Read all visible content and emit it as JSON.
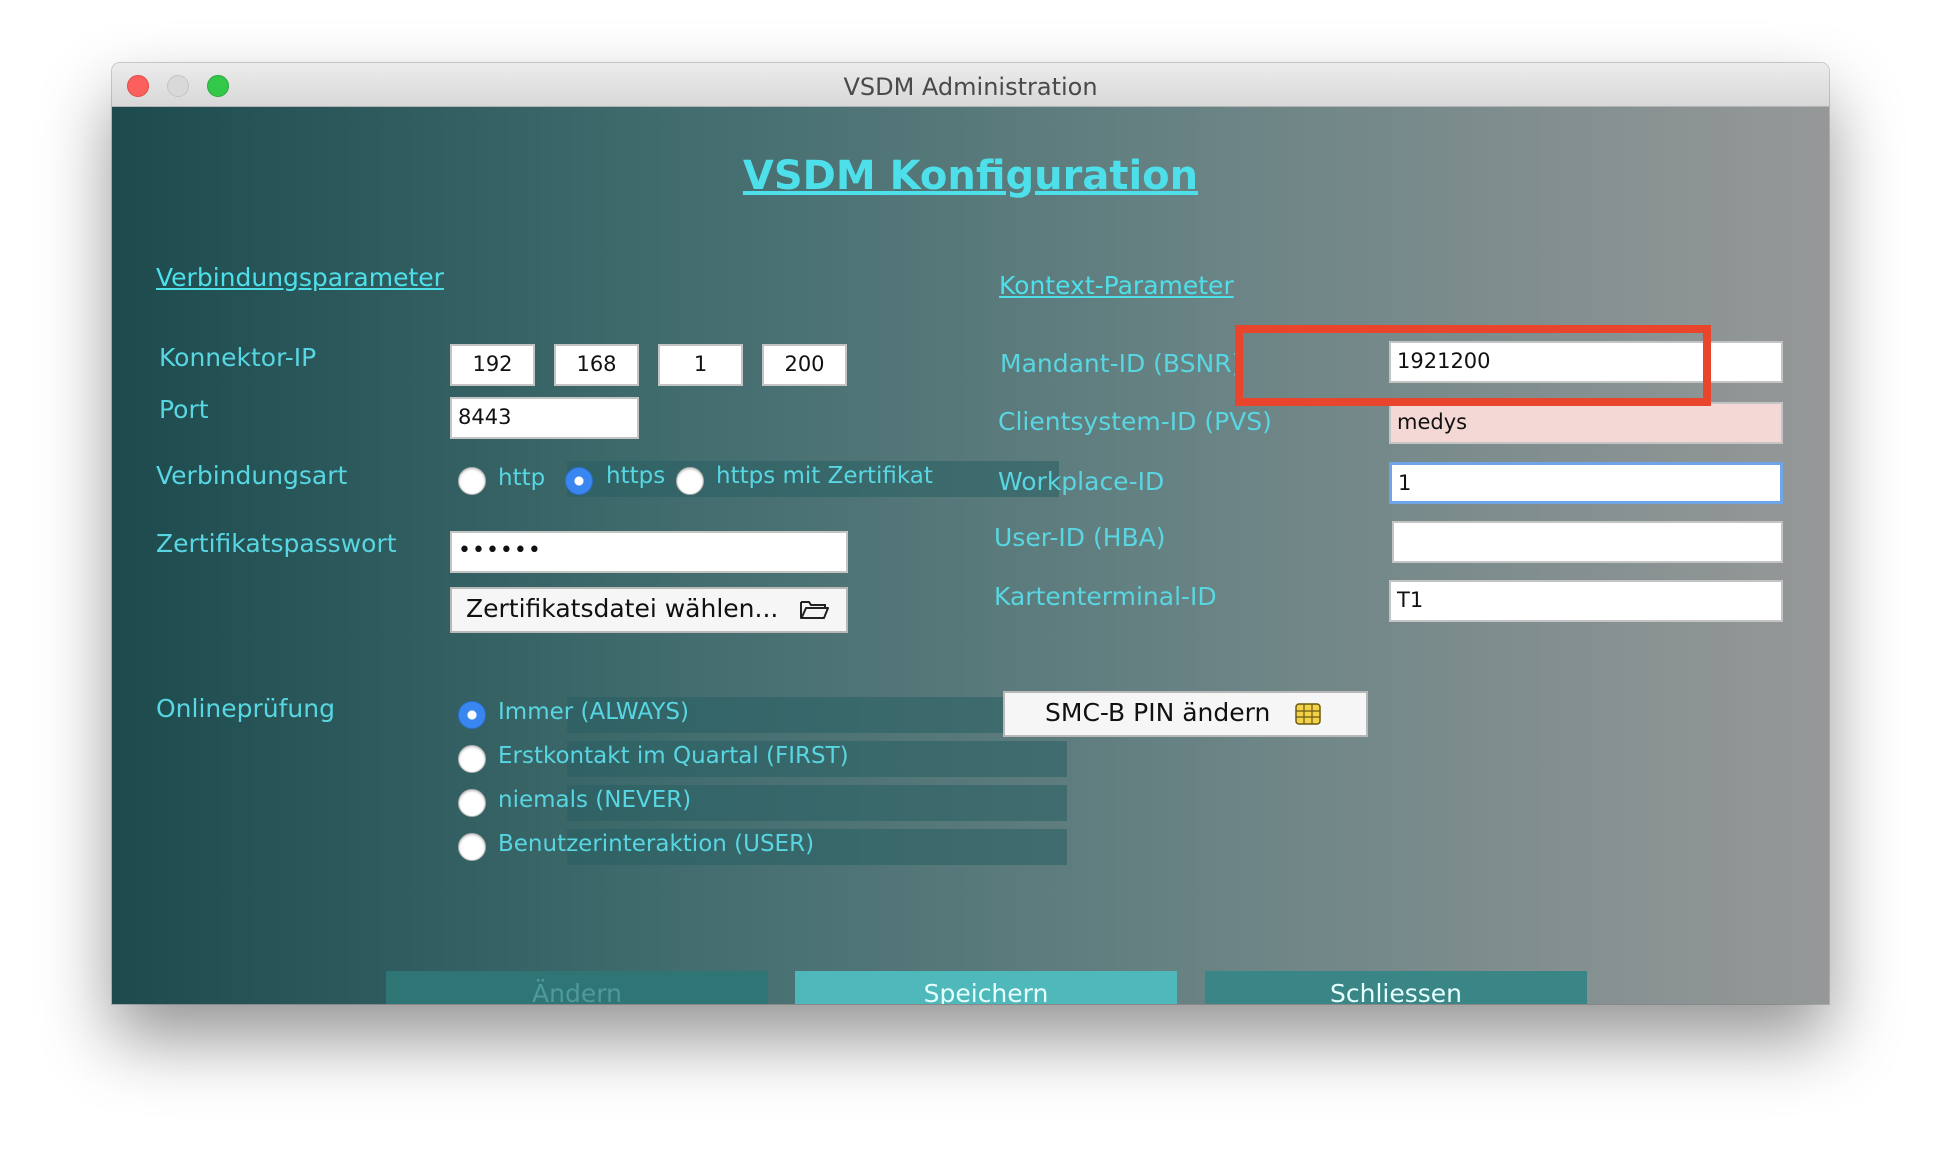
{
  "window": {
    "title": "VSDM Administration"
  },
  "heading": "VSDM Konfiguration",
  "connection": {
    "section_title": "Verbindungsparameter",
    "ip_label": "Konnektor-IP",
    "ip": [
      "192",
      "168",
      "1",
      "200"
    ],
    "port_label": "Port",
    "port": "8443",
    "mode_label": "Verbindungsart",
    "modes": [
      {
        "label": "http",
        "selected": false
      },
      {
        "label": "https",
        "selected": true
      },
      {
        "label": "https mit Zertifikat",
        "selected": false
      }
    ],
    "cert_password_label": "Zertifikatspasswort",
    "cert_password": "••••••",
    "cert_file_button": "Zertifikatsdatei wählen...",
    "cert_file_icon": "folder-open-icon"
  },
  "online_check": {
    "label": "Onlineprüfung",
    "options": [
      {
        "label": "Immer (ALWAYS)",
        "selected": true
      },
      {
        "label": "Erstkontakt im Quartal (FIRST)",
        "selected": false
      },
      {
        "label": "niemals (NEVER)",
        "selected": false
      },
      {
        "label": "Benutzerinteraktion (USER)",
        "selected": false
      }
    ]
  },
  "context": {
    "section_title": "Kontext-Parameter",
    "fields": [
      {
        "label": "Mandant-ID (BSNR)",
        "value": "1921200"
      },
      {
        "label": "Clientsystem-ID (PVS)",
        "value": "medys"
      },
      {
        "label": "Workplace-ID",
        "value": "1"
      },
      {
        "label": "User-ID (HBA)",
        "value": ""
      },
      {
        "label": "Kartenterminal-ID",
        "value": "T1"
      }
    ],
    "smcb_button": "SMC-B PIN ändern",
    "smcb_icon": "chip-card-icon"
  },
  "actions": {
    "change": "Ändern",
    "save": "Speichern",
    "close": "Schliessen"
  },
  "colors": {
    "accent_text": "#4ee0ea",
    "highlight_box": "#e8452c",
    "save_button": "#4fb8ba",
    "close_button": "#3a8686",
    "change_button_disabled": "#2f7576"
  }
}
